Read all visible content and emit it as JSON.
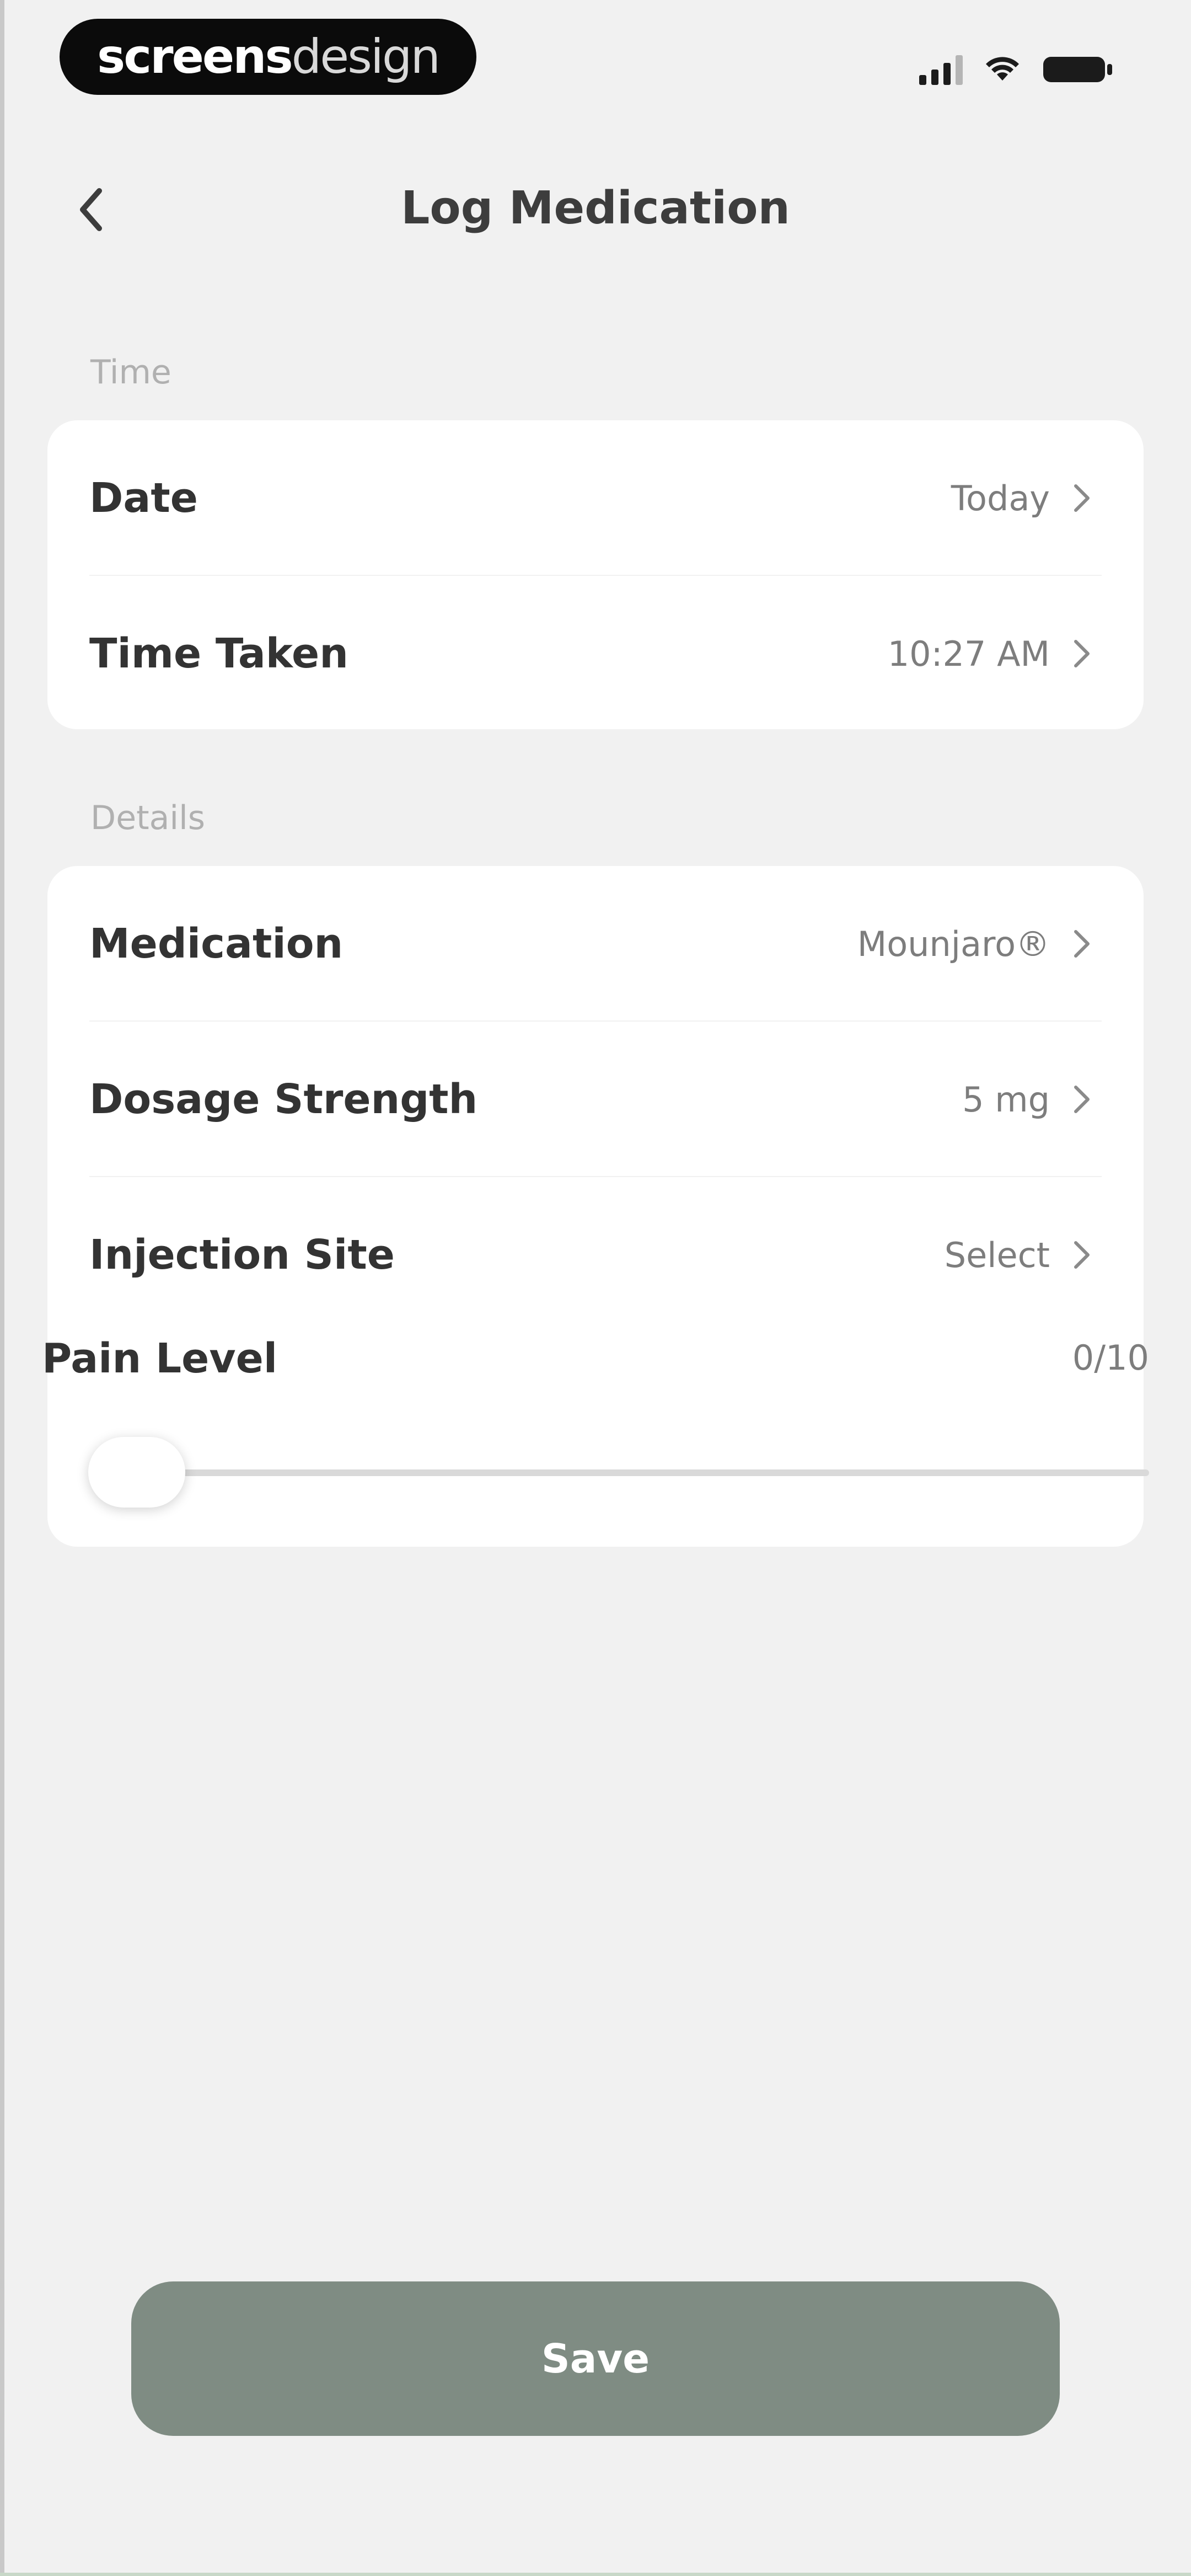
{
  "status_bar": {
    "brand_bold": "screens",
    "brand_light": "design",
    "icons": [
      "signal-icon",
      "wifi-icon",
      "battery-icon"
    ]
  },
  "header": {
    "title": "Log Medication",
    "back_icon": "chevron-left-icon"
  },
  "sections": {
    "time": {
      "label": "Time",
      "rows": [
        {
          "label": "Date",
          "value": "Today"
        },
        {
          "label": "Time Taken",
          "value": "10:27 AM"
        }
      ]
    },
    "details": {
      "label": "Details",
      "rows": [
        {
          "label": "Medication",
          "value": "Mounjaro®"
        },
        {
          "label": "Dosage Strength",
          "value": "5 mg"
        },
        {
          "label": "Injection Site",
          "value": "Select"
        }
      ],
      "pain": {
        "label": "Pain Level",
        "value": "0/10",
        "level": 0,
        "max": 10
      }
    }
  },
  "actions": {
    "save_label": "Save"
  },
  "colors": {
    "background": "#f1f1f1",
    "card": "#ffffff",
    "save_button": "#7f8c83",
    "secondary_text": "#7d7d7d"
  }
}
